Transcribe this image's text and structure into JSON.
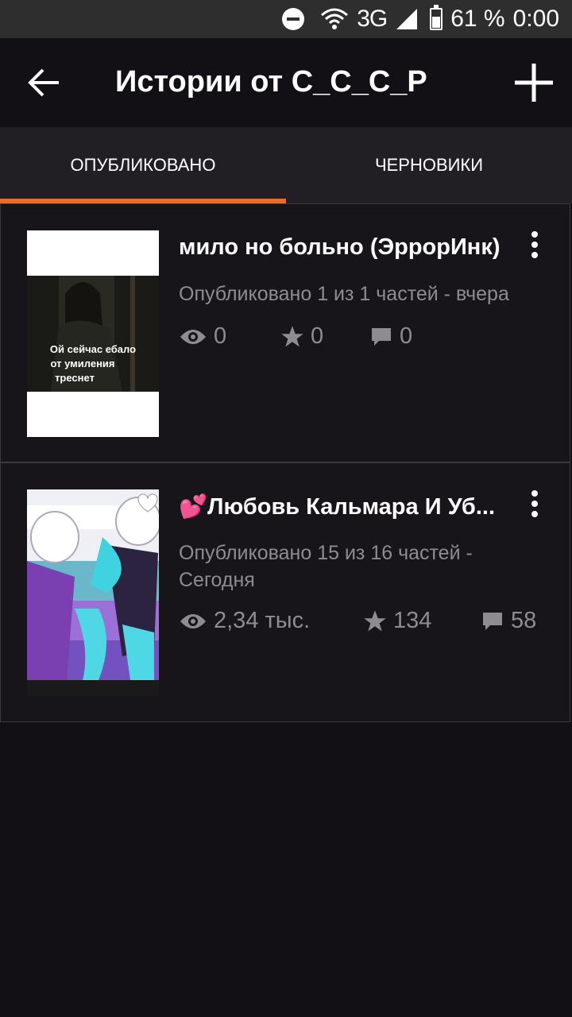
{
  "status_bar": {
    "network": "3G",
    "battery": "61 %",
    "time": "0:00"
  },
  "app_bar": {
    "title": "Истории от С_С_С_Р"
  },
  "tabs": [
    {
      "label": "ОПУБЛИКОВАНО",
      "active": true
    },
    {
      "label": "ЧЕРНОВИКИ",
      "active": false
    }
  ],
  "stories": [
    {
      "title": "мило но больно (ЭррорИнк)",
      "status": "Опубликовано 1 из 1 частей - вчера",
      "views": "0",
      "votes": "0",
      "comments": "0",
      "cover_text": "Ой сейчас ебало от умиления треснет"
    },
    {
      "title": "💕Любовь Кальмара И Уб...",
      "status": "Опубликовано 15 из 16 частей - Сегодня",
      "views": "2,34 тыс.",
      "votes": "134",
      "comments": "58"
    }
  ],
  "colors": {
    "accent": "#f26a21",
    "background": "#121014",
    "tab_bar": "#211f24",
    "muted_text": "#8e8c92"
  }
}
